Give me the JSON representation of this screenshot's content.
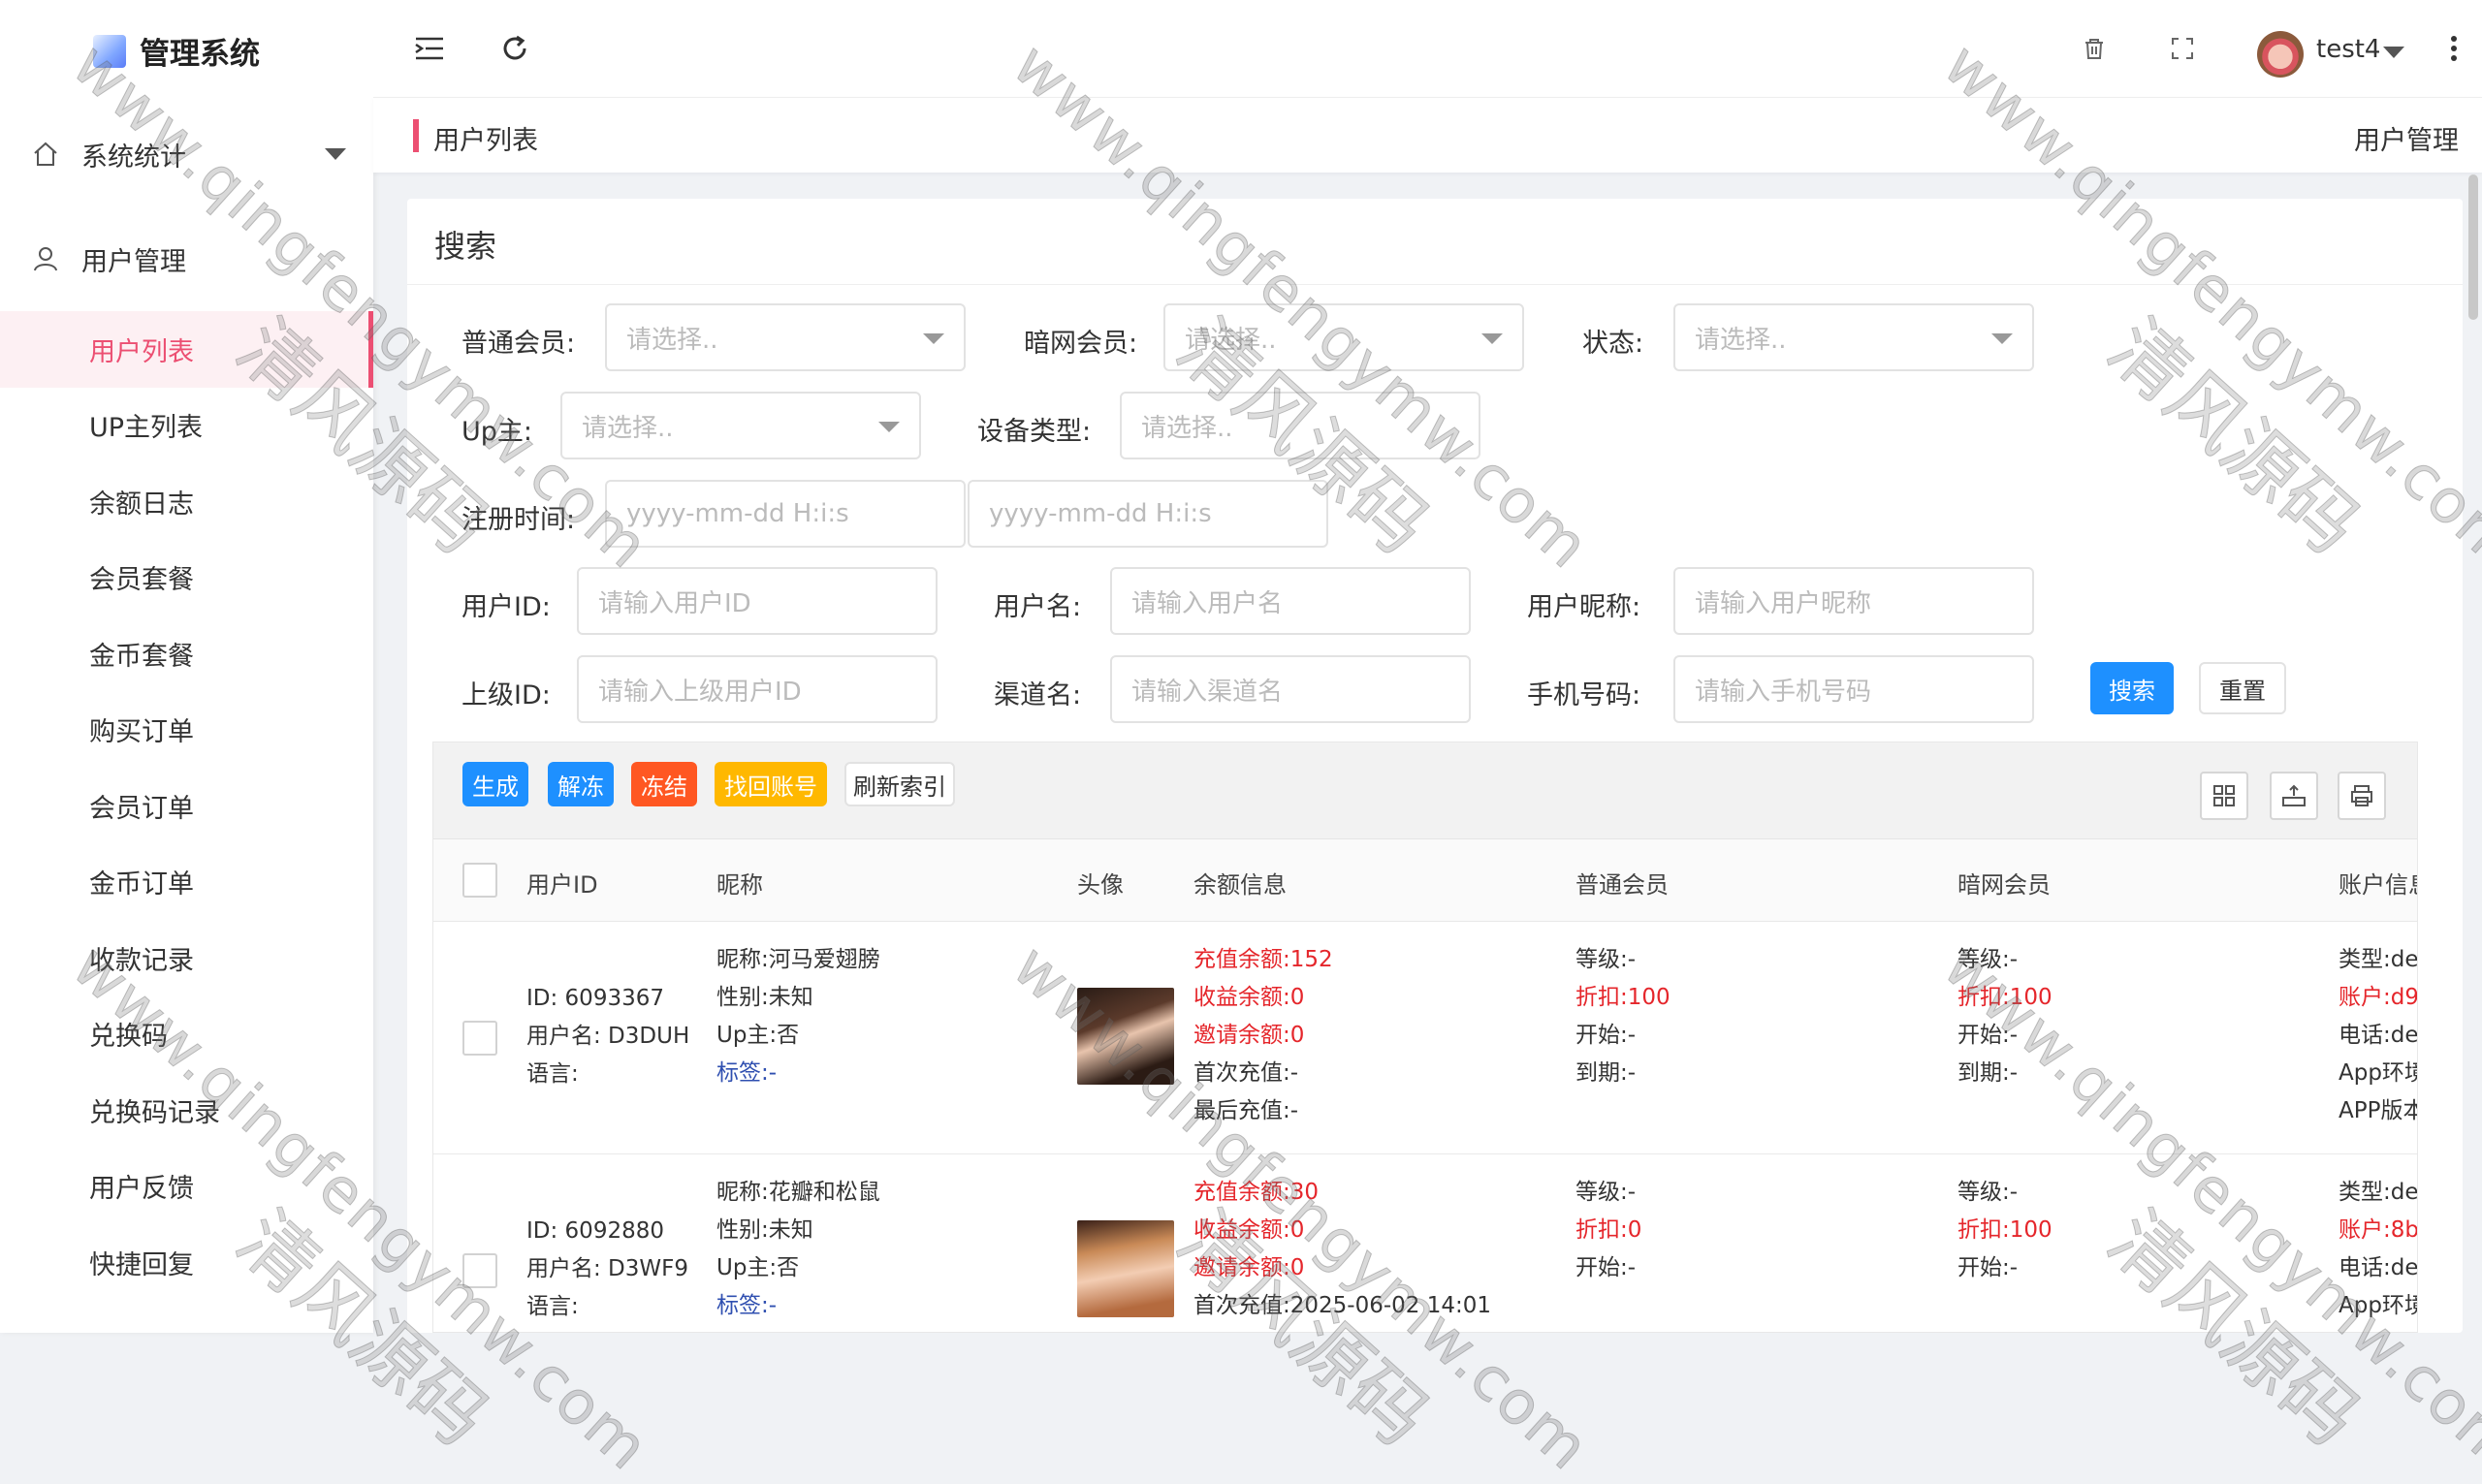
{
  "app": {
    "title": "管理系统"
  },
  "sidebar": {
    "groups": [
      {
        "label": "系统统计",
        "icon": "home-icon"
      },
      {
        "label": "用户管理",
        "icon": "user-icon"
      }
    ],
    "items": [
      "用户列表",
      "UP主列表",
      "余额日志",
      "会员套餐",
      "金币套餐",
      "购买订单",
      "会员订单",
      "金币订单",
      "收款记录",
      "兑换码",
      "兑换码记录",
      "用户反馈",
      "快捷回复"
    ]
  },
  "header": {
    "username": "test4"
  },
  "breadcrumb": {
    "current": "用户列表",
    "section": "用户管理"
  },
  "search": {
    "title": "搜索",
    "fields": {
      "normal_member": {
        "label": "普通会员:",
        "placeholder": "请选择.."
      },
      "dark_member": {
        "label": "暗网会员:",
        "placeholder": "请选择.."
      },
      "status": {
        "label": "状态:",
        "placeholder": "请选择.."
      },
      "up": {
        "label": "Up主:",
        "placeholder": "请选择.."
      },
      "device_type": {
        "label": "设备类型:",
        "placeholder": "请选择.."
      },
      "register_time": {
        "label": "注册时间:",
        "placeholder_start": "yyyy-mm-dd H:i:s",
        "placeholder_end": "yyyy-mm-dd H:i:s"
      },
      "user_id": {
        "label": "用户ID:",
        "placeholder": "请输入用户ID"
      },
      "username": {
        "label": "用户名:",
        "placeholder": "请输入用户名"
      },
      "nickname": {
        "label": "用户昵称:",
        "placeholder": "请输入用户昵称"
      },
      "parent_id": {
        "label": "上级ID:",
        "placeholder": "请输入上级用户ID"
      },
      "channel": {
        "label": "渠道名:",
        "placeholder": "请输入渠道名"
      },
      "phone": {
        "label": "手机号码:",
        "placeholder": "请输入手机号码"
      }
    },
    "search_button": "搜索",
    "reset_button": "重置"
  },
  "toolbar": {
    "generate": "生成",
    "unfreeze": "解冻",
    "freeze": "冻结",
    "recover": "找回账号",
    "refresh_index": "刷新索引"
  },
  "table": {
    "columns": [
      "用户ID",
      "昵称",
      "头像",
      "余额信息",
      "普通会员",
      "暗网会员",
      "账户信息"
    ],
    "rows": [
      {
        "id": "ID: 6093367",
        "username": "用户名: D3DUH",
        "language": "语言:",
        "nickname": "昵称:河马爱翅膀",
        "gender": "性别:未知",
        "is_up": "Up主:否",
        "tag": "标签:-",
        "recharge": "充值余额:152",
        "income": "收益余额:0",
        "invite": "邀请余额:0",
        "first_recharge": "首次充值:-",
        "last_recharge": "最后充值:-",
        "nm_level": "等级:-",
        "nm_discount": "折扣:100",
        "nm_start": "开始:-",
        "nm_end": "到期:-",
        "dm_level": "等级:-",
        "dm_discount": "折扣:100",
        "dm_start": "开始:-",
        "dm_end": "到期:-",
        "acc_type": "类型:de",
        "acc_account": "账户:d9",
        "acc_phone": "电话:de",
        "acc_env": "App环境",
        "acc_version": "APP版本"
      },
      {
        "id": "ID: 6092880",
        "username": "用户名: D3WF9",
        "language": "语言:",
        "nickname": "昵称:花瓣和松鼠",
        "gender": "性别:未知",
        "is_up": "Up主:否",
        "tag": "标签:-",
        "recharge": "充值余额:30",
        "income": "收益余额:0",
        "invite": "邀请余额:0",
        "first_recharge": "首次充值:2025-06-02 14:01",
        "nm_level": "等级:-",
        "nm_discount": "折扣:0",
        "nm_start": "开始:-",
        "dm_level": "等级:-",
        "dm_discount": "折扣:100",
        "dm_start": "开始:-",
        "acc_type": "类型:de",
        "acc_account": "账户:8b",
        "acc_phone": "电话:de",
        "acc_env": "App环境"
      }
    ]
  },
  "watermark": {
    "url": "www.qingfengymw.com",
    "cn": "清风源码"
  },
  "colors": {
    "accent": "#ec4f72",
    "primary": "#1e90ff",
    "danger": "#e5262b",
    "orange": "#ff5722",
    "amber": "#ffb800"
  }
}
